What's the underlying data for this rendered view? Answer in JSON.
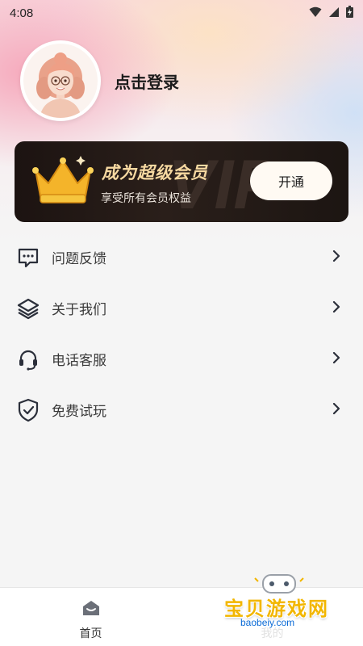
{
  "status_bar": {
    "time": "4:08",
    "icons": [
      "wifi-icon",
      "signal-icon",
      "battery-charging-icon"
    ]
  },
  "profile": {
    "login_label": "点击登录"
  },
  "vip": {
    "title": "成为超级会员",
    "subtitle": "享受所有会员权益",
    "button_label": "开通",
    "watermark_text": "VIP",
    "accent_color": "#f7d9a1",
    "card_color": "#1c1311"
  },
  "menu": {
    "items": [
      {
        "label": "问题反馈",
        "icon": "chat-bubble-icon"
      },
      {
        "label": "关于我们",
        "icon": "layers-icon"
      },
      {
        "label": "电话客服",
        "icon": "headset-icon"
      },
      {
        "label": "免费试玩",
        "icon": "shield-check-icon"
      }
    ]
  },
  "tabbar": {
    "home_label": "首页",
    "mine_label": "我的"
  },
  "watermark": {
    "site_name": "宝贝游戏网",
    "site_url": "baobeiy.com"
  }
}
